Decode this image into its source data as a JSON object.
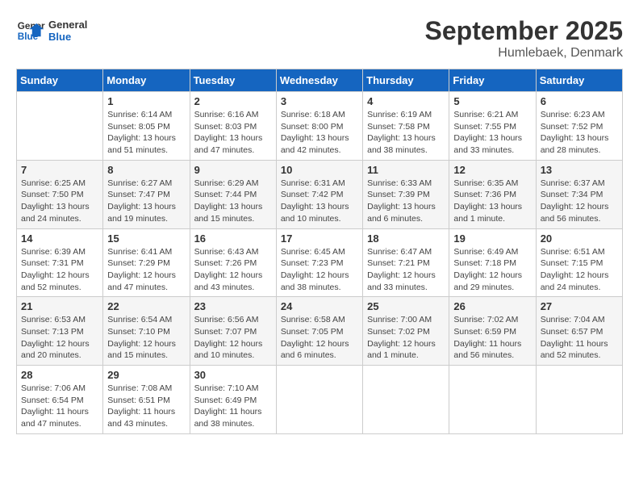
{
  "header": {
    "logo_line1": "General",
    "logo_line2": "Blue",
    "month_title": "September 2025",
    "location": "Humlebaek, Denmark"
  },
  "weekdays": [
    "Sunday",
    "Monday",
    "Tuesday",
    "Wednesday",
    "Thursday",
    "Friday",
    "Saturday"
  ],
  "weeks": [
    [
      {
        "day": "",
        "info": ""
      },
      {
        "day": "1",
        "info": "Sunrise: 6:14 AM\nSunset: 8:05 PM\nDaylight: 13 hours\nand 51 minutes."
      },
      {
        "day": "2",
        "info": "Sunrise: 6:16 AM\nSunset: 8:03 PM\nDaylight: 13 hours\nand 47 minutes."
      },
      {
        "day": "3",
        "info": "Sunrise: 6:18 AM\nSunset: 8:00 PM\nDaylight: 13 hours\nand 42 minutes."
      },
      {
        "day": "4",
        "info": "Sunrise: 6:19 AM\nSunset: 7:58 PM\nDaylight: 13 hours\nand 38 minutes."
      },
      {
        "day": "5",
        "info": "Sunrise: 6:21 AM\nSunset: 7:55 PM\nDaylight: 13 hours\nand 33 minutes."
      },
      {
        "day": "6",
        "info": "Sunrise: 6:23 AM\nSunset: 7:52 PM\nDaylight: 13 hours\nand 28 minutes."
      }
    ],
    [
      {
        "day": "7",
        "info": "Sunrise: 6:25 AM\nSunset: 7:50 PM\nDaylight: 13 hours\nand 24 minutes."
      },
      {
        "day": "8",
        "info": "Sunrise: 6:27 AM\nSunset: 7:47 PM\nDaylight: 13 hours\nand 19 minutes."
      },
      {
        "day": "9",
        "info": "Sunrise: 6:29 AM\nSunset: 7:44 PM\nDaylight: 13 hours\nand 15 minutes."
      },
      {
        "day": "10",
        "info": "Sunrise: 6:31 AM\nSunset: 7:42 PM\nDaylight: 13 hours\nand 10 minutes."
      },
      {
        "day": "11",
        "info": "Sunrise: 6:33 AM\nSunset: 7:39 PM\nDaylight: 13 hours\nand 6 minutes."
      },
      {
        "day": "12",
        "info": "Sunrise: 6:35 AM\nSunset: 7:36 PM\nDaylight: 13 hours\nand 1 minute."
      },
      {
        "day": "13",
        "info": "Sunrise: 6:37 AM\nSunset: 7:34 PM\nDaylight: 12 hours\nand 56 minutes."
      }
    ],
    [
      {
        "day": "14",
        "info": "Sunrise: 6:39 AM\nSunset: 7:31 PM\nDaylight: 12 hours\nand 52 minutes."
      },
      {
        "day": "15",
        "info": "Sunrise: 6:41 AM\nSunset: 7:29 PM\nDaylight: 12 hours\nand 47 minutes."
      },
      {
        "day": "16",
        "info": "Sunrise: 6:43 AM\nSunset: 7:26 PM\nDaylight: 12 hours\nand 43 minutes."
      },
      {
        "day": "17",
        "info": "Sunrise: 6:45 AM\nSunset: 7:23 PM\nDaylight: 12 hours\nand 38 minutes."
      },
      {
        "day": "18",
        "info": "Sunrise: 6:47 AM\nSunset: 7:21 PM\nDaylight: 12 hours\nand 33 minutes."
      },
      {
        "day": "19",
        "info": "Sunrise: 6:49 AM\nSunset: 7:18 PM\nDaylight: 12 hours\nand 29 minutes."
      },
      {
        "day": "20",
        "info": "Sunrise: 6:51 AM\nSunset: 7:15 PM\nDaylight: 12 hours\nand 24 minutes."
      }
    ],
    [
      {
        "day": "21",
        "info": "Sunrise: 6:53 AM\nSunset: 7:13 PM\nDaylight: 12 hours\nand 20 minutes."
      },
      {
        "day": "22",
        "info": "Sunrise: 6:54 AM\nSunset: 7:10 PM\nDaylight: 12 hours\nand 15 minutes."
      },
      {
        "day": "23",
        "info": "Sunrise: 6:56 AM\nSunset: 7:07 PM\nDaylight: 12 hours\nand 10 minutes."
      },
      {
        "day": "24",
        "info": "Sunrise: 6:58 AM\nSunset: 7:05 PM\nDaylight: 12 hours\nand 6 minutes."
      },
      {
        "day": "25",
        "info": "Sunrise: 7:00 AM\nSunset: 7:02 PM\nDaylight: 12 hours\nand 1 minute."
      },
      {
        "day": "26",
        "info": "Sunrise: 7:02 AM\nSunset: 6:59 PM\nDaylight: 11 hours\nand 56 minutes."
      },
      {
        "day": "27",
        "info": "Sunrise: 7:04 AM\nSunset: 6:57 PM\nDaylight: 11 hours\nand 52 minutes."
      }
    ],
    [
      {
        "day": "28",
        "info": "Sunrise: 7:06 AM\nSunset: 6:54 PM\nDaylight: 11 hours\nand 47 minutes."
      },
      {
        "day": "29",
        "info": "Sunrise: 7:08 AM\nSunset: 6:51 PM\nDaylight: 11 hours\nand 43 minutes."
      },
      {
        "day": "30",
        "info": "Sunrise: 7:10 AM\nSunset: 6:49 PM\nDaylight: 11 hours\nand 38 minutes."
      },
      {
        "day": "",
        "info": ""
      },
      {
        "day": "",
        "info": ""
      },
      {
        "day": "",
        "info": ""
      },
      {
        "day": "",
        "info": ""
      }
    ]
  ]
}
